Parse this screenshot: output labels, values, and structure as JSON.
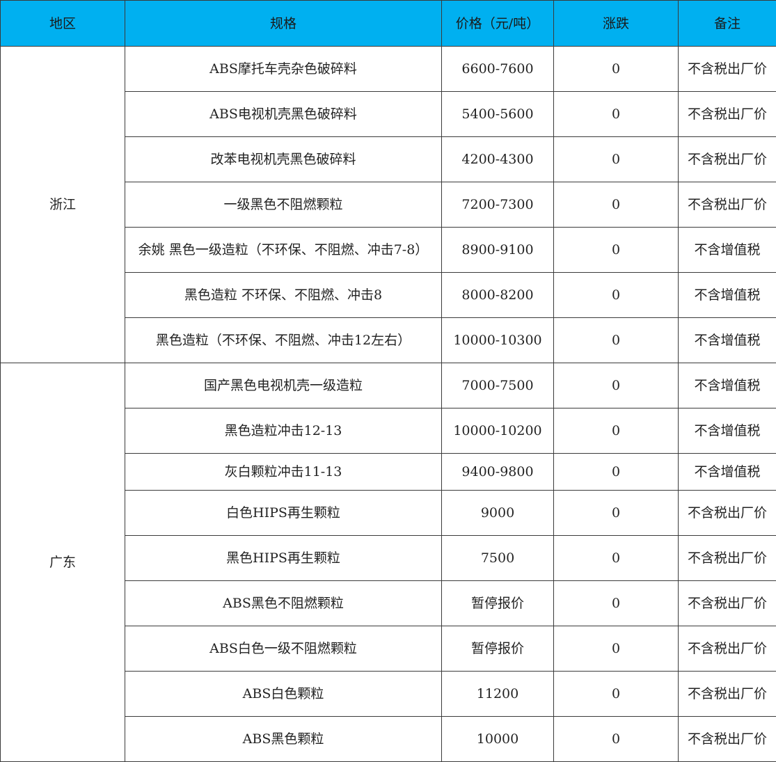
{
  "header": {
    "region": "地区",
    "spec": "规格",
    "price": "价格（元/吨）",
    "change": "涨跌",
    "note": "备注"
  },
  "groups": [
    {
      "region": "浙江",
      "rows": [
        {
          "spec": "ABS摩托车壳杂色破碎料",
          "price": "6600-7600",
          "change": "0",
          "note": "不含税出厂价"
        },
        {
          "spec": "ABS电视机壳黑色破碎料",
          "price": "5400-5600",
          "change": "0",
          "note": "不含税出厂价"
        },
        {
          "spec": "改苯电视机壳黑色破碎料",
          "price": "4200-4300",
          "change": "0",
          "note": "不含税出厂价"
        },
        {
          "spec": "一级黑色不阻燃颗粒",
          "price": "7200-7300",
          "change": "0",
          "note": "不含税出厂价"
        },
        {
          "spec": "余姚 黑色一级造粒（不环保、不阻燃、冲击7-8）",
          "price": "8900-9100",
          "change": "0",
          "note": "不含增值税"
        },
        {
          "spec": "黑色造粒 不环保、不阻燃、冲击8",
          "price": "8000-8200",
          "change": "0",
          "note": "不含增值税"
        },
        {
          "spec": "黑色造粒（不环保、不阻燃、冲击12左右）",
          "price": "10000-10300",
          "change": "0",
          "note": "不含增值税"
        }
      ]
    },
    {
      "region": "广东",
      "rows": [
        {
          "spec": "国产黑色电视机壳一级造粒",
          "price": "7000-7500",
          "change": "0",
          "note": "不含增值税"
        },
        {
          "spec": "黑色造粒冲击12-13",
          "price": "10000-10200",
          "change": "0",
          "note": "不含增值税"
        },
        {
          "spec": "灰白颗粒冲击11-13",
          "price": "9400-9800",
          "change": "0",
          "note": "不含增值税"
        },
        {
          "spec": "白色HIPS再生颗粒",
          "price": "9000",
          "change": "0",
          "note": "不含税出厂价"
        },
        {
          "spec": "黑色HIPS再生颗粒",
          "price": "7500",
          "change": "0",
          "note": "不含税出厂价"
        },
        {
          "spec": "ABS黑色不阻燃颗粒",
          "price": "暂停报价",
          "change": "0",
          "note": "不含税出厂价"
        },
        {
          "spec": "ABS白色一级不阻燃颗粒",
          "price": "暂停报价",
          "change": "0",
          "note": "不含税出厂价"
        },
        {
          "spec": "ABS白色颗粒",
          "price": "11200",
          "change": "0",
          "note": "不含税出厂价"
        },
        {
          "spec": "ABS黑色颗粒",
          "price": "10000",
          "change": "0",
          "note": "不含税出厂价"
        }
      ]
    }
  ]
}
